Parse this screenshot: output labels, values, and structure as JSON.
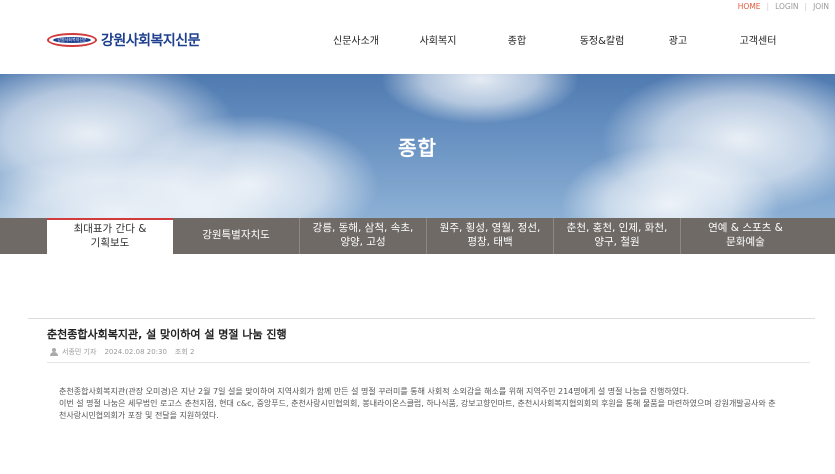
{
  "util": {
    "home": "HOME",
    "login": "LOGIN",
    "join": "JOIN",
    "sep": "|"
  },
  "logo": {
    "mark_text": "강원사회복지신문",
    "text": "강원사회복지신문"
  },
  "gnb": [
    "신문사소개",
    "사회복지",
    "종합",
    "동정&칼럼",
    "광고",
    "고객센터"
  ],
  "banner": {
    "title": "종합"
  },
  "tabs": [
    {
      "line1": "최대표가 간다 &",
      "line2": "기획보도"
    },
    {
      "line1": "강원특별자치도",
      "line2": ""
    },
    {
      "line1": "강릉, 동해, 삼척, 속초,",
      "line2": "양양, 고성"
    },
    {
      "line1": "원주, 횡성, 영월, 정선,",
      "line2": "평창, 태백"
    },
    {
      "line1": "춘천, 홍천, 인제, 화천,",
      "line2": "양구, 철원"
    },
    {
      "line1": "연예 & 스포츠 &",
      "line2": "문화예술"
    }
  ],
  "article": {
    "title": "춘천종합사회복지관, 설 맞이하여 설 명절 나눔 진행",
    "author": "서종민 기자",
    "date": "2024.02.08 20:30",
    "views": "조회 2",
    "p1": "춘천종합사회복지관(관장 오미경)은 지난 2월 7일 설을 맞이하여 지역사회가 함께 만든 설 명절 꾸러미를 통해 사회적 소외감을 해소를 위해 지역주민 214명에게 설 명절 나눔을 진행하였다.",
    "p2": "이번 설 명절 나눔은 세무법인 로고스 춘천지점, 현대 c&c, 중앙푸드, 춘천사랑시민협의회, 봉내라이온스클럽, 하나식품, 강보고향인마트, 춘천시사회복지협의회의 후원을 통해 물품을 마련하였으며 강원개발공사와 춘천사랑시민협의회가 포장 및 전달을 지원하였다."
  },
  "colors": {
    "brand_blue": "#1d3f8f",
    "brand_red": "#d23b3b",
    "home_accent": "#e05a3a",
    "tab_bg": "#6f6a66"
  }
}
